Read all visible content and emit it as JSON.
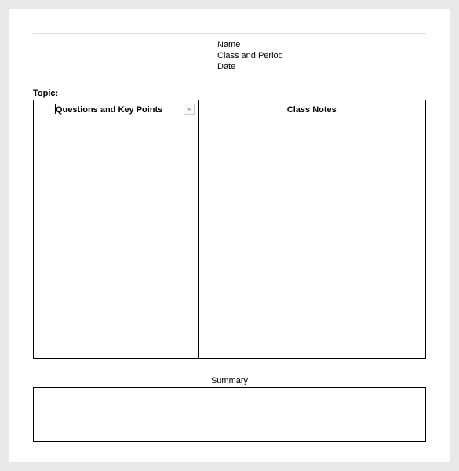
{
  "header": {
    "name_label": "Name",
    "class_period_label": "Class and Period",
    "date_label": "Date"
  },
  "topic": {
    "label": "Topic:"
  },
  "columns": {
    "left_header": "Questions and Key Points",
    "right_header": "Class Notes"
  },
  "summary": {
    "label": "Summary"
  }
}
